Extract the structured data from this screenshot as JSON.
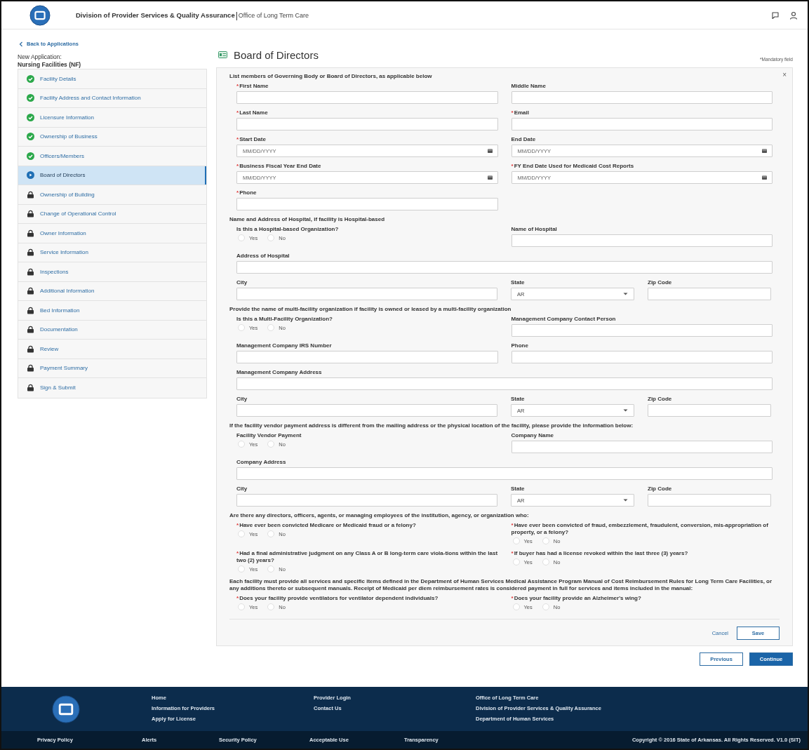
{
  "header": {
    "title": "Division of Provider Services & Quality Assurance",
    "separator": "|",
    "subtitle": "Office of Long Term Care"
  },
  "sidebar": {
    "back_link": "Back to Applications",
    "application_label": "New Application:",
    "application_type": "Nursing Facilities (NF)",
    "items": [
      {
        "label": "Facility Details",
        "kind": "done",
        "selected": false
      },
      {
        "label": "Facility Address and Contact Information",
        "kind": "done",
        "selected": false
      },
      {
        "label": "Licensure Information",
        "kind": "done",
        "selected": false
      },
      {
        "label": "Ownership of Business",
        "kind": "done",
        "selected": false
      },
      {
        "label": "Officers/Members",
        "kind": "done",
        "selected": false
      },
      {
        "label": "Board of Directors",
        "kind": "current",
        "selected": true
      },
      {
        "label": "Ownership of Building",
        "kind": "locked",
        "selected": false
      },
      {
        "label": "Change of Operational Control",
        "kind": "locked",
        "selected": false
      },
      {
        "label": "Owner Information",
        "kind": "locked",
        "selected": false
      },
      {
        "label": "Service Information",
        "kind": "locked",
        "selected": false
      },
      {
        "label": "Inspections",
        "kind": "locked",
        "selected": false
      },
      {
        "label": "Additional Information",
        "kind": "locked",
        "selected": false
      },
      {
        "label": "Bed Information",
        "kind": "locked",
        "selected": false
      },
      {
        "label": "Documentation",
        "kind": "locked",
        "selected": false
      },
      {
        "label": "Review",
        "kind": "locked",
        "selected": false
      },
      {
        "label": "Payment Summary",
        "kind": "locked",
        "selected": false
      },
      {
        "label": "Sign & Submit",
        "kind": "locked",
        "selected": false
      }
    ]
  },
  "page": {
    "title": "Board of Directors",
    "mandatory_note": "*Mandatory field"
  },
  "form": {
    "rows": [
      {
        "kind": "heading",
        "text": "List members of Governing Body or Board of Directors, as applicable below"
      },
      {
        "kind": "pair",
        "fields": [
          {
            "kind": "text",
            "label": "First Name",
            "required": true
          },
          {
            "kind": "text",
            "label": "Middle Name",
            "required": false
          }
        ]
      },
      {
        "kind": "pair",
        "fields": [
          {
            "kind": "text",
            "label": "Last Name",
            "required": true
          },
          {
            "kind": "text",
            "label": "Email",
            "required": true
          }
        ]
      },
      {
        "kind": "pair",
        "fields": [
          {
            "kind": "date",
            "label": "Start Date",
            "required": true,
            "placeholder": "MM/DD/YYYY"
          },
          {
            "kind": "date",
            "label": "End Date",
            "required": false,
            "placeholder": "MM/DD/YYYY"
          }
        ]
      },
      {
        "kind": "pair",
        "fields": [
          {
            "kind": "date",
            "label": "Business Fiscal Year End Date",
            "required": true,
            "placeholder": "MM/DD/YYYY"
          },
          {
            "kind": "date",
            "label": "FY End Date Used for Medicaid Cost Reports",
            "required": true,
            "placeholder": "MM/DD/YYYY"
          }
        ]
      },
      {
        "kind": "pair",
        "fields": [
          {
            "kind": "text",
            "label": "Phone",
            "required": true
          }
        ]
      },
      {
        "kind": "heading",
        "text": "Name and Address of Hospital, if facility is Hospital-based"
      },
      {
        "kind": "pair",
        "fields": [
          {
            "kind": "radio",
            "label": "Is this a Hospital-based Organization?",
            "required": false,
            "options": [
              {
                "label": "Yes",
                "selected": false
              },
              {
                "label": "No",
                "selected": false
              }
            ]
          },
          {
            "kind": "text",
            "label": "Name of Hospital",
            "required": false
          }
        ]
      },
      {
        "kind": "full",
        "fields": [
          {
            "kind": "text",
            "label": "Address of Hospital",
            "required": false
          }
        ]
      },
      {
        "kind": "address",
        "fields": [
          {
            "kind": "text",
            "label": "City",
            "required": false
          },
          {
            "kind": "select",
            "label": "State",
            "required": false,
            "value": "AR"
          },
          {
            "kind": "text",
            "label": "Zip Code",
            "required": false
          }
        ]
      },
      {
        "kind": "heading",
        "text": "Provide the name of multi-facility organization if facility is owned or leased by a multi-facility organization"
      },
      {
        "kind": "pair",
        "fields": [
          {
            "kind": "radio",
            "label": "Is this a Multi-Facility Organization?",
            "required": false,
            "options": [
              {
                "label": "Yes",
                "selected": false
              },
              {
                "label": "No",
                "selected": false
              }
            ]
          },
          {
            "kind": "text",
            "label": "Management Company Contact Person",
            "required": false
          }
        ]
      },
      {
        "kind": "pair",
        "fields": [
          {
            "kind": "text",
            "label": "Management Company IRS Number",
            "required": false
          },
          {
            "kind": "text",
            "label": "Phone",
            "required": false
          }
        ]
      },
      {
        "kind": "full",
        "fields": [
          {
            "kind": "text",
            "label": "Management Company Address",
            "required": false
          }
        ]
      },
      {
        "kind": "address",
        "fields": [
          {
            "kind": "text",
            "label": "City",
            "required": false
          },
          {
            "kind": "select",
            "label": "State",
            "required": false,
            "value": "AR"
          },
          {
            "kind": "text",
            "label": "Zip Code",
            "required": false
          }
        ]
      },
      {
        "kind": "heading",
        "text": "If the facility vendor payment address is different from the mailing address or the physical location of the facility, please provide the information below:"
      },
      {
        "kind": "pair",
        "fields": [
          {
            "kind": "radio",
            "label": "Facility Vendor Payment",
            "required": false,
            "options": [
              {
                "label": "Yes",
                "selected": false
              },
              {
                "label": "No",
                "selected": false
              }
            ]
          },
          {
            "kind": "text",
            "label": "Company Name",
            "required": false
          }
        ]
      },
      {
        "kind": "full",
        "fields": [
          {
            "kind": "text",
            "label": "Company Address",
            "required": false
          }
        ]
      },
      {
        "kind": "address",
        "fields": [
          {
            "kind": "text",
            "label": "City",
            "required": false
          },
          {
            "kind": "select",
            "label": "State",
            "required": false,
            "value": "AR"
          },
          {
            "kind": "text",
            "label": "Zip Code",
            "required": false
          }
        ]
      },
      {
        "kind": "heading",
        "text": "Are there any directors, officers, agents, or managing employees of the institution, agency, or organization who:"
      },
      {
        "kind": "pair",
        "fields": [
          {
            "kind": "radio",
            "label": "Have ever been convicted Medicare or Medicaid fraud or a felony?",
            "required": true,
            "options": [
              {
                "label": "Yes",
                "selected": false
              },
              {
                "label": "No",
                "selected": false
              }
            ]
          },
          {
            "kind": "radio",
            "label": "Have ever been convicted of fraud, embezzlement, fraudulent, conversion, mis-appropriation of property, or a felony?",
            "required": true,
            "options": [
              {
                "label": "Yes",
                "selected": false
              },
              {
                "label": "No",
                "selected": false
              }
            ]
          }
        ]
      },
      {
        "kind": "pair",
        "fields": [
          {
            "kind": "radio",
            "label": "Had a final administrative judgment on any Class A or B long-term care viola-tions within the last two (2) years?",
            "required": true,
            "options": [
              {
                "label": "Yes",
                "selected": false
              },
              {
                "label": "No",
                "selected": false
              }
            ]
          },
          {
            "kind": "radio",
            "label": "If buyer has had a license revoked within the last three (3) years?",
            "required": true,
            "options": [
              {
                "label": "Yes",
                "selected": false
              },
              {
                "label": "No",
                "selected": false
              }
            ]
          }
        ]
      },
      {
        "kind": "heading",
        "text": "Each facility must provide all services and specific items defined in the Department of Human Services Medical Assistance Program Manual of Cost Reimbursement Rules for Long Term Care Facilities, or any additions thereto or subsequent manuals. Receipt of Medicaid per diem reimbursement rates is considered payment in full for services and items included in the manual:"
      },
      {
        "kind": "pair",
        "fields": [
          {
            "kind": "radio",
            "label": "Does your facility provide ventilators for ventilator dependent individuals?",
            "required": true,
            "options": [
              {
                "label": "Yes",
                "selected": false
              },
              {
                "label": "No",
                "selected": false
              }
            ]
          },
          {
            "kind": "radio",
            "label": "Does your facility provide an Alzheimer's wing?",
            "required": true,
            "options": [
              {
                "label": "Yes",
                "selected": false
              },
              {
                "label": "No",
                "selected": false
              }
            ]
          }
        ]
      }
    ],
    "required_mark": "*",
    "close_label": "×",
    "cancel": "Cancel",
    "save": "Save"
  },
  "nav_buttons": {
    "previous": "Previous",
    "continue": "Continue"
  },
  "footer": {
    "columns": [
      [
        "Home",
        "Information for Providers",
        "Apply for License"
      ],
      [
        "Provider Login",
        "Contact Us"
      ],
      [
        "Office of Long Term Care",
        "Division of Provider Services & Quality Assurance",
        "Department of Human Services"
      ]
    ],
    "bottom_links": [
      "Privacy Policy",
      "Alerts",
      "Security Policy",
      "Acceptable Use",
      "Transparency"
    ],
    "copyright": "Copyright © 2016 State of Arkansas. All Rights Reserved. V1.0 (SIT)"
  }
}
